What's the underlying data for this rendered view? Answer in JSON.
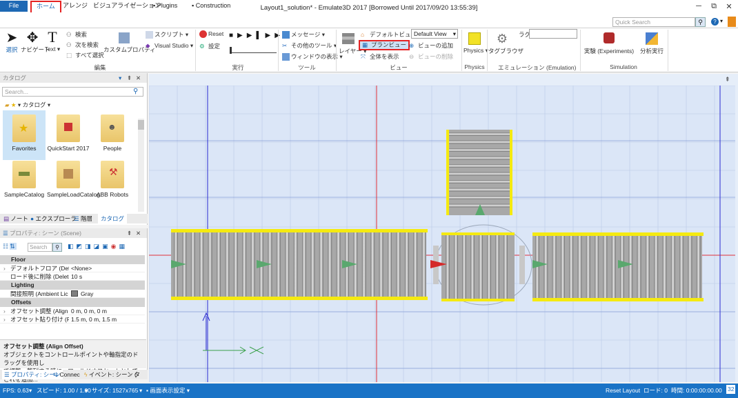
{
  "title": "Layout1_solution* - Emulate3D 2017 [Borrowed Until 2017/09/20 13:55:39]",
  "tabs": [
    "File",
    "ホーム",
    "アレンジ",
    "ビジュアライゼーション",
    "Plugins",
    "Construction"
  ],
  "search_placeholder": "Quick Search",
  "ribbon": {
    "select": "選択",
    "navigate": "ナビゲート",
    "text": "Text",
    "search": "検索",
    "search_next": "次を検索",
    "select_all": "すべて選択",
    "custom_props": "カスタムプロパティ",
    "script": "スクリプト",
    "visual_studio": "Visual Studio",
    "group_edit": "編集",
    "reset": "Reset",
    "settings": "設定",
    "group_run": "実行",
    "messages": "メッセージ",
    "other_tools": "その他のツール",
    "window_show": "ウィンドウの表示",
    "group_tools": "ツール",
    "layer": "レイヤー",
    "default_view_btn": "デフォルトビュー",
    "plan_view": "プランビュー",
    "show_all": "全体を表示",
    "add_view": "ビューの追加",
    "delete_view": "ビューの削除",
    "view_select": "Default View",
    "group_view": "ビュー",
    "physics": "Physics",
    "group_physics": "Physics",
    "tag_browser": "タグブラウザ",
    "tag_label": "ラグ",
    "group_emulation": "エミュレーション (Emulation)",
    "experiments": "実験 (Experiments)",
    "analysis": "分析実行",
    "group_simulation": "Simulation"
  },
  "catalog": {
    "title": "カタログ",
    "search_placeholder": "Search...",
    "breadcrumb": "カタログ",
    "items": [
      "Favorites",
      "QuickStart 2017",
      "People",
      "SampleCatalog",
      "SampleLoadCatalog",
      "ABB Robots"
    ],
    "tabs": [
      "ノート",
      "エクスプローラ",
      "階層",
      "カタログ"
    ]
  },
  "properties": {
    "title": "プロパティ: シーン (Scene)",
    "search_placeholder": "Search",
    "sections": [
      {
        "name": "Floor",
        "rows": [
          {
            "k": "デフォルトフロア (Default",
            "v": "<None>"
          },
          {
            "k": "ロード後に削除 (Delete",
            "v": "10 s"
          }
        ]
      },
      {
        "name": "Lighting",
        "rows": [
          {
            "k": "間接照明 (Ambient Lic",
            "v": "Gray"
          }
        ]
      },
      {
        "name": "Offsets",
        "rows": [
          {
            "k": "オフセット調整 (Align O",
            "v": "0 m, 0 m, 0 m"
          },
          {
            "k": "オフセット貼り付け (Paste",
            "v": "1.5 m, 0 m, 1.5 m"
          }
        ]
      }
    ],
    "desc_title": "オフセット調整 (Align Offset)",
    "desc_line1": "オブジェクトをコントロールポイントや軸指定のドラッグを使用し",
    "desc_line2": "て調整・整列する時に、ワールドオフセットとしてこれを追加...",
    "bottom_tabs": [
      "プロパティ: シーン",
      "Connec",
      "イベント: シーン (",
      "タ"
    ]
  },
  "status": {
    "fps": "FPS: 0.63",
    "speed": "スピード: 1.00 / 1.00",
    "size": "サイズ: 1527x765",
    "screen": "画面表示設定",
    "reset_layout": "Reset Layout",
    "load": "ロード: 0",
    "time": "時間: 0:00:00:00.00",
    "counter": "32"
  },
  "colors": {
    "accent": "#1d68b4",
    "status": "#1a73c6",
    "highlight": "#e52222",
    "conveyor_edge": "#f5ea10",
    "arrow": "#5aa86e",
    "arrow_red": "#d42a2a"
  }
}
